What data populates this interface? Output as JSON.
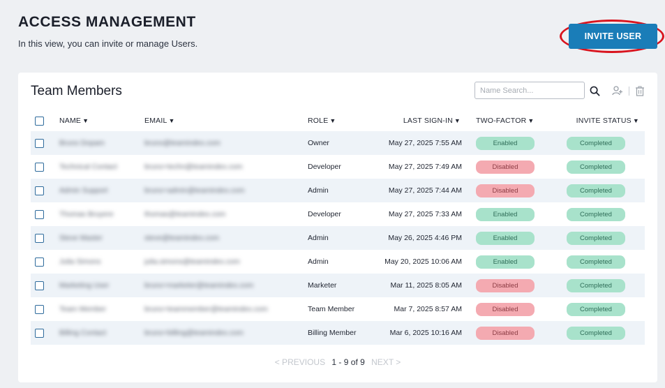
{
  "header": {
    "title": "ACCESS MANAGEMENT",
    "subtitle": "In this view, you can invite or manage Users.",
    "invite_label": "INVITE USER"
  },
  "card": {
    "title": "Team Members",
    "search_placeholder": "Name Search...",
    "icons": [
      "search-icon",
      "add-user-icon",
      "trash-icon"
    ]
  },
  "columns": {
    "name": "NAME",
    "email": "EMAIL",
    "role": "ROLE",
    "last_signin": "LAST SIGN-IN",
    "two_factor": "TWO-FACTOR",
    "invite_status": "INVITE STATUS",
    "sort_glyph": "▼"
  },
  "rows": [
    {
      "name": "Bruno Dopam",
      "email": "bruno@teamindex.com",
      "role": "Owner",
      "last_signin": "May 27, 2025 7:55 AM",
      "two_factor": "Enabled",
      "invite_status": "Completed"
    },
    {
      "name": "Technical Contact",
      "email": "bruno+techn@teamindex.com",
      "role": "Developer",
      "last_signin": "May 27, 2025 7:49 AM",
      "two_factor": "Disabled",
      "invite_status": "Completed"
    },
    {
      "name": "Admin Support",
      "email": "bruno+admin@teamindex.com",
      "role": "Admin",
      "last_signin": "May 27, 2025 7:44 AM",
      "two_factor": "Disabled",
      "invite_status": "Completed"
    },
    {
      "name": "Thomas Bruyere",
      "email": "thomas@teamindex.com",
      "role": "Developer",
      "last_signin": "May 27, 2025 7:33 AM",
      "two_factor": "Enabled",
      "invite_status": "Completed"
    },
    {
      "name": "Steve Master",
      "email": "steve@teamindex.com",
      "role": "Admin",
      "last_signin": "May 26, 2025 4:46 PM",
      "two_factor": "Enabled",
      "invite_status": "Completed"
    },
    {
      "name": "Julia Simons",
      "email": "julia.simons@teamindex.com",
      "role": "Admin",
      "last_signin": "May 20, 2025 10:06 AM",
      "two_factor": "Enabled",
      "invite_status": "Completed"
    },
    {
      "name": "Marketing User",
      "email": "bruno+marketer@teamindex.com",
      "role": "Marketer",
      "last_signin": "Mar 11, 2025 8:05 AM",
      "two_factor": "Disabled",
      "invite_status": "Completed"
    },
    {
      "name": "Team Member",
      "email": "bruno+teammember@teamindex.com",
      "role": "Team Member",
      "last_signin": "Mar 7, 2025 8:57 AM",
      "two_factor": "Disabled",
      "invite_status": "Completed"
    },
    {
      "name": "Billing Contact",
      "email": "bruno+billing@teamindex.com",
      "role": "Billing Member",
      "last_signin": "Mar 6, 2025 10:16 AM",
      "two_factor": "Disabled",
      "invite_status": "Completed"
    }
  ],
  "pagination": {
    "prev": "< PREVIOUS",
    "range": "1 - 9 of 9",
    "next": "NEXT >"
  },
  "colors": {
    "accent": "#1a7db8",
    "highlight_ring": "#d9141e",
    "enabled_bg": "#a8e2cb",
    "disabled_bg": "#f4aab1"
  }
}
